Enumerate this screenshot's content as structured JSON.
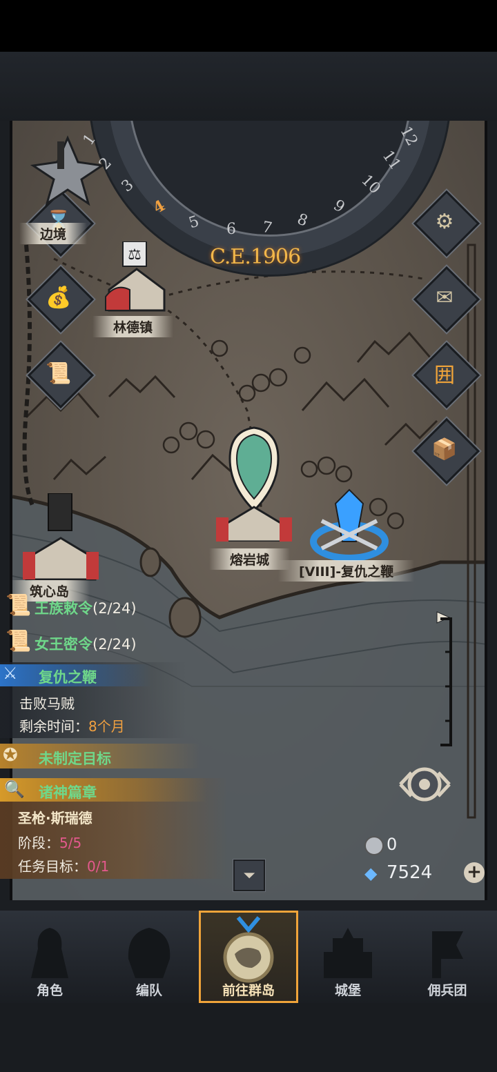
{
  "calendar": {
    "year": "C.E.1906",
    "months": [
      "1",
      "2",
      "3",
      "4",
      "5",
      "6",
      "7",
      "8",
      "9",
      "10",
      "11",
      "12"
    ],
    "current_month": "4"
  },
  "map": {
    "places": [
      {
        "name": "边境"
      },
      {
        "name": "林德镇"
      },
      {
        "name": "熔岩城"
      },
      {
        "name": "[VIII]-复仇之鞭"
      },
      {
        "name": "筑心岛"
      }
    ]
  },
  "side_buttons": [
    {
      "icon": "gear-icon"
    },
    {
      "icon": "mail-icon"
    },
    {
      "icon": "calendar-icon",
      "accent": "#f0a43a"
    },
    {
      "icon": "supplies-icon"
    }
  ],
  "left_buttons": [
    {
      "icon": "hourglass-icon"
    },
    {
      "icon": "money-bag-icon"
    },
    {
      "icon": "scroll-icon"
    }
  ],
  "quests": {
    "royal_decree": {
      "label": "王族敕令",
      "progress": "(2/24)"
    },
    "queen_order": {
      "label": "女王密令",
      "progress": "(2/24)"
    },
    "main": {
      "title": "复仇之鞭",
      "task": "击败马贼",
      "time_label": "剩余时间：",
      "time_value": "8个月"
    },
    "goal": {
      "label": "未制定目标"
    },
    "gods": {
      "title": "诸神篇章",
      "hero": "圣枪·斯瑞德",
      "stage_label": "阶段：",
      "stage_value": "5/5",
      "target_label": "任务目标：",
      "target_value": "0/1"
    }
  },
  "resources": {
    "silver": "0",
    "crystal": "7524"
  },
  "nav": [
    {
      "label": "角色",
      "active": false
    },
    {
      "label": "编队",
      "active": false
    },
    {
      "label": "前往群岛",
      "active": true
    },
    {
      "label": "城堡",
      "active": false
    },
    {
      "label": "佣兵团",
      "active": false
    }
  ],
  "colors": {
    "accent_gold": "#f0a43a",
    "quest_green": "#6fd78a",
    "progress_pink": "#e4598d",
    "army_blue": "#2f8fe0"
  }
}
